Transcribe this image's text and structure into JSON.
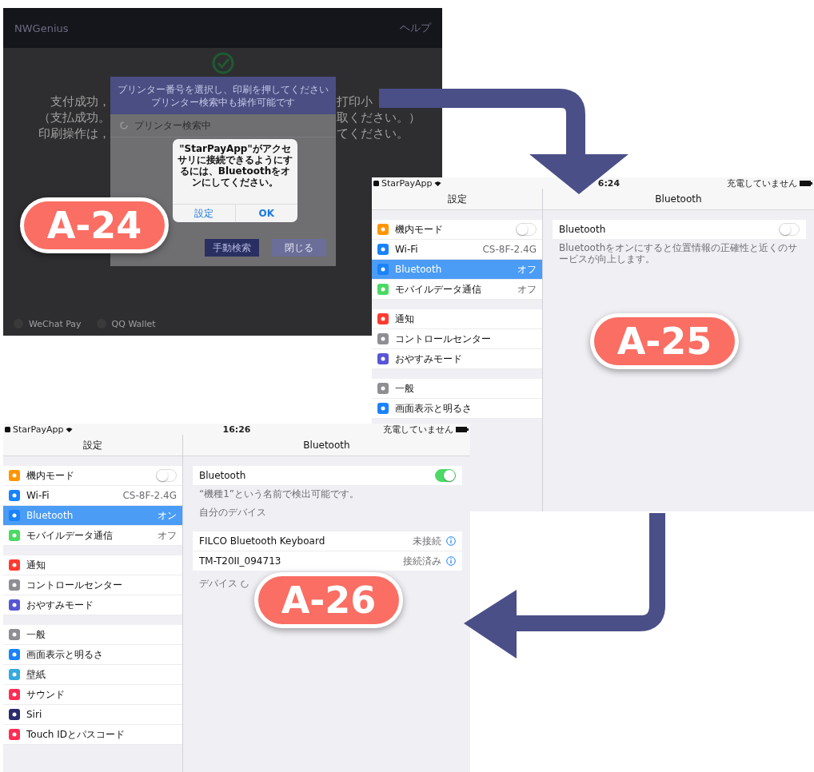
{
  "screens": [
    {
      "kind": "payment",
      "badge": "A-24",
      "app_title": "NWGenius",
      "help": "ヘルプ",
      "background_left": [
        "支付成功，",
        "（支払成功。",
        "印刷操作は，"
      ],
      "background_right": [
        "打印小",
        "取ください。）",
        "てください。"
      ],
      "dialog": {
        "title_lines": [
          "プリンター番号を選択し、印刷を押してください",
          "プリンター検索中も操作可能です"
        ],
        "searching": "プリンター検索中",
        "buttons": [
          {
            "label": "手動検索",
            "disabled": false
          },
          {
            "label": "閉じる",
            "disabled": true
          }
        ]
      },
      "alert": {
        "message": "\"StarPayApp\"がアクセサリに接続できるようにするには、Bluetoothをオンにしてください。",
        "buttons": [
          {
            "label": "設定",
            "bold": false
          },
          {
            "label": "OK",
            "bold": true
          }
        ]
      },
      "footer": [
        "WeChat Pay",
        "QQ Wallet"
      ]
    },
    {
      "kind": "settings",
      "badge": "A-25",
      "status": {
        "carrier": "StarPayApp",
        "time": "6:24",
        "battery": "充電していません"
      },
      "sidebar": {
        "title": "設定",
        "groups": [
          {
            "items": [
              {
                "kind": "toggle",
                "label": "機内モード",
                "on": false,
                "selected": false,
                "color": "#ff9500"
              },
              {
                "kind": "value",
                "label": "Wi-Fi",
                "value": "CS-8F-2.4G",
                "selected": false,
                "color": "#1a82fb"
              },
              {
                "kind": "value",
                "label": "Bluetooth",
                "value": "オフ",
                "selected": true,
                "color": "#1a82fb"
              },
              {
                "kind": "value",
                "label": "モバイルデータ通信",
                "value": "オフ",
                "selected": false,
                "color": "#4cd964"
              }
            ]
          },
          {
            "items": [
              {
                "kind": "plain",
                "label": "通知",
                "selected": false,
                "color": "#ff3b30"
              },
              {
                "kind": "plain",
                "label": "コントロールセンター",
                "selected": false,
                "color": "#8e8e93"
              },
              {
                "kind": "plain",
                "label": "おやすみモード",
                "selected": false,
                "color": "#5856d6"
              }
            ]
          },
          {
            "items": [
              {
                "kind": "plain",
                "label": "一般",
                "selected": false,
                "color": "#8e8e93"
              },
              {
                "kind": "plain",
                "label": "画面表示と明るさ",
                "selected": false,
                "color": "#1a82fb"
              }
            ]
          }
        ]
      },
      "detail": {
        "title": "Bluetooth",
        "toggle": {
          "label": "Bluetooth",
          "on": false
        },
        "note": "Bluetoothをオンにすると位置情報の正確性と近くのサービスが向上します。"
      }
    },
    {
      "kind": "settings",
      "badge": "A-26",
      "status": {
        "carrier": "StarPayApp",
        "time": "16:26",
        "battery": "充電していません"
      },
      "sidebar": {
        "title": "設定",
        "groups": [
          {
            "items": [
              {
                "kind": "toggle",
                "label": "機内モード",
                "on": false,
                "selected": false,
                "color": "#ff9500"
              },
              {
                "kind": "value",
                "label": "Wi-Fi",
                "value": "CS-8F-2.4G",
                "selected": false,
                "color": "#1a82fb"
              },
              {
                "kind": "value",
                "label": "Bluetooth",
                "value": "オン",
                "selected": true,
                "color": "#1a82fb"
              },
              {
                "kind": "value",
                "label": "モバイルデータ通信",
                "value": "オフ",
                "selected": false,
                "color": "#4cd964"
              }
            ]
          },
          {
            "items": [
              {
                "kind": "plain",
                "label": "通知",
                "selected": false,
                "color": "#ff3b30"
              },
              {
                "kind": "plain",
                "label": "コントロールセンター",
                "selected": false,
                "color": "#8e8e93"
              },
              {
                "kind": "plain",
                "label": "おやすみモード",
                "selected": false,
                "color": "#5856d6"
              }
            ]
          },
          {
            "items": [
              {
                "kind": "plain",
                "label": "一般",
                "selected": false,
                "color": "#8e8e93"
              },
              {
                "kind": "plain",
                "label": "画面表示と明るさ",
                "selected": false,
                "color": "#1a82fb"
              },
              {
                "kind": "plain",
                "label": "壁紙",
                "selected": false,
                "color": "#35aadc"
              },
              {
                "kind": "plain",
                "label": "サウンド",
                "selected": false,
                "color": "#ff2d55"
              },
              {
                "kind": "plain",
                "label": "Siri",
                "selected": false,
                "color": "#2b2b6e"
              },
              {
                "kind": "plain",
                "label": "Touch IDとパスコード",
                "selected": false,
                "color": "#ff2d55"
              }
            ]
          }
        ]
      },
      "detail": {
        "title": "Bluetooth",
        "toggle": {
          "label": "Bluetooth",
          "on": true
        },
        "note": "“機種1”という名前で検出可能です。",
        "section": "自分のデバイス",
        "devices": [
          {
            "name": "FILCO Bluetooth Keyboard",
            "status": "未接続"
          },
          {
            "name": "TM-T20II_094713",
            "status": "接続済み"
          }
        ],
        "searching": "デバイス"
      }
    }
  ]
}
